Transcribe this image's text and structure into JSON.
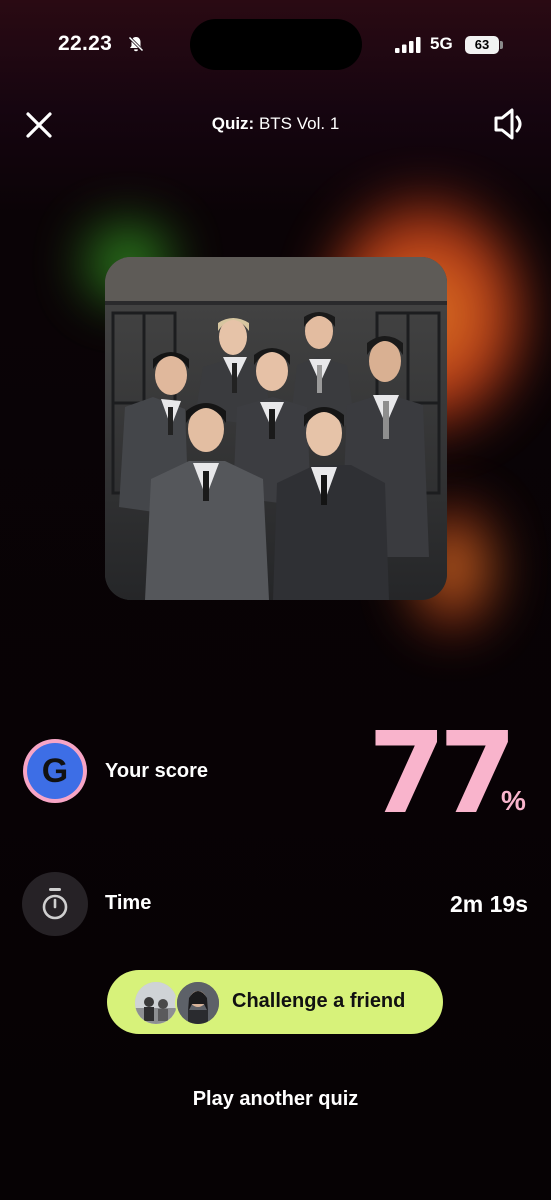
{
  "status_bar": {
    "time": "22.23",
    "network": "5G",
    "battery": "63",
    "icons": [
      "bell-off-icon",
      "signal-bars-icon",
      "battery-icon"
    ]
  },
  "header": {
    "title_prefix": "Quiz:",
    "title_name": "BTS Vol. 1",
    "icons": [
      "close-icon",
      "speaker-icon"
    ]
  },
  "cover": {
    "icon": "group-photo"
  },
  "score": {
    "avatar_letter": "G",
    "label": "Your score",
    "value": "77",
    "unit": "%"
  },
  "time": {
    "label": "Time",
    "value": "2m 19s",
    "icon": "stopwatch-icon"
  },
  "actions": {
    "challenge_label": "Challenge a friend",
    "play_another_label": "Play another quiz"
  },
  "colors": {
    "background": "#080306",
    "accent_pink": "#f9b4cc",
    "button_green": "#d7f27a",
    "avatar_blue": "#3d6ee6"
  }
}
